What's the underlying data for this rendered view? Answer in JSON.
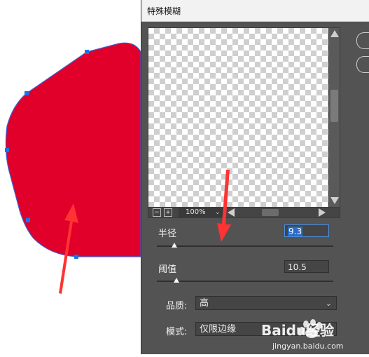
{
  "dialog": {
    "title": "特殊模糊",
    "zoom": "100%",
    "radius": {
      "label": "半径",
      "value": "9.3",
      "fraction": 0.1
    },
    "threshold": {
      "label": "阈值",
      "value": "10.5",
      "fraction": 0.11
    },
    "quality": {
      "label": "品质:",
      "value": "高"
    },
    "mode": {
      "label": "模式:",
      "value": "仅限边缘"
    }
  },
  "watermark": {
    "brand": "Baidu经验",
    "url": "jingyan.baidu.com"
  },
  "colors": {
    "shape_fill": "#e0002a",
    "shape_stroke": "#3a5fd0",
    "handle": "#1a73e8",
    "arrow": "#ff3333",
    "panel_bg": "#535353"
  },
  "icons": [
    "zoom-out-icon",
    "zoom-in-icon",
    "chevron-down-icon",
    "scroll-up-icon",
    "scroll-down-icon",
    "scroll-left-icon",
    "scroll-right-icon"
  ]
}
